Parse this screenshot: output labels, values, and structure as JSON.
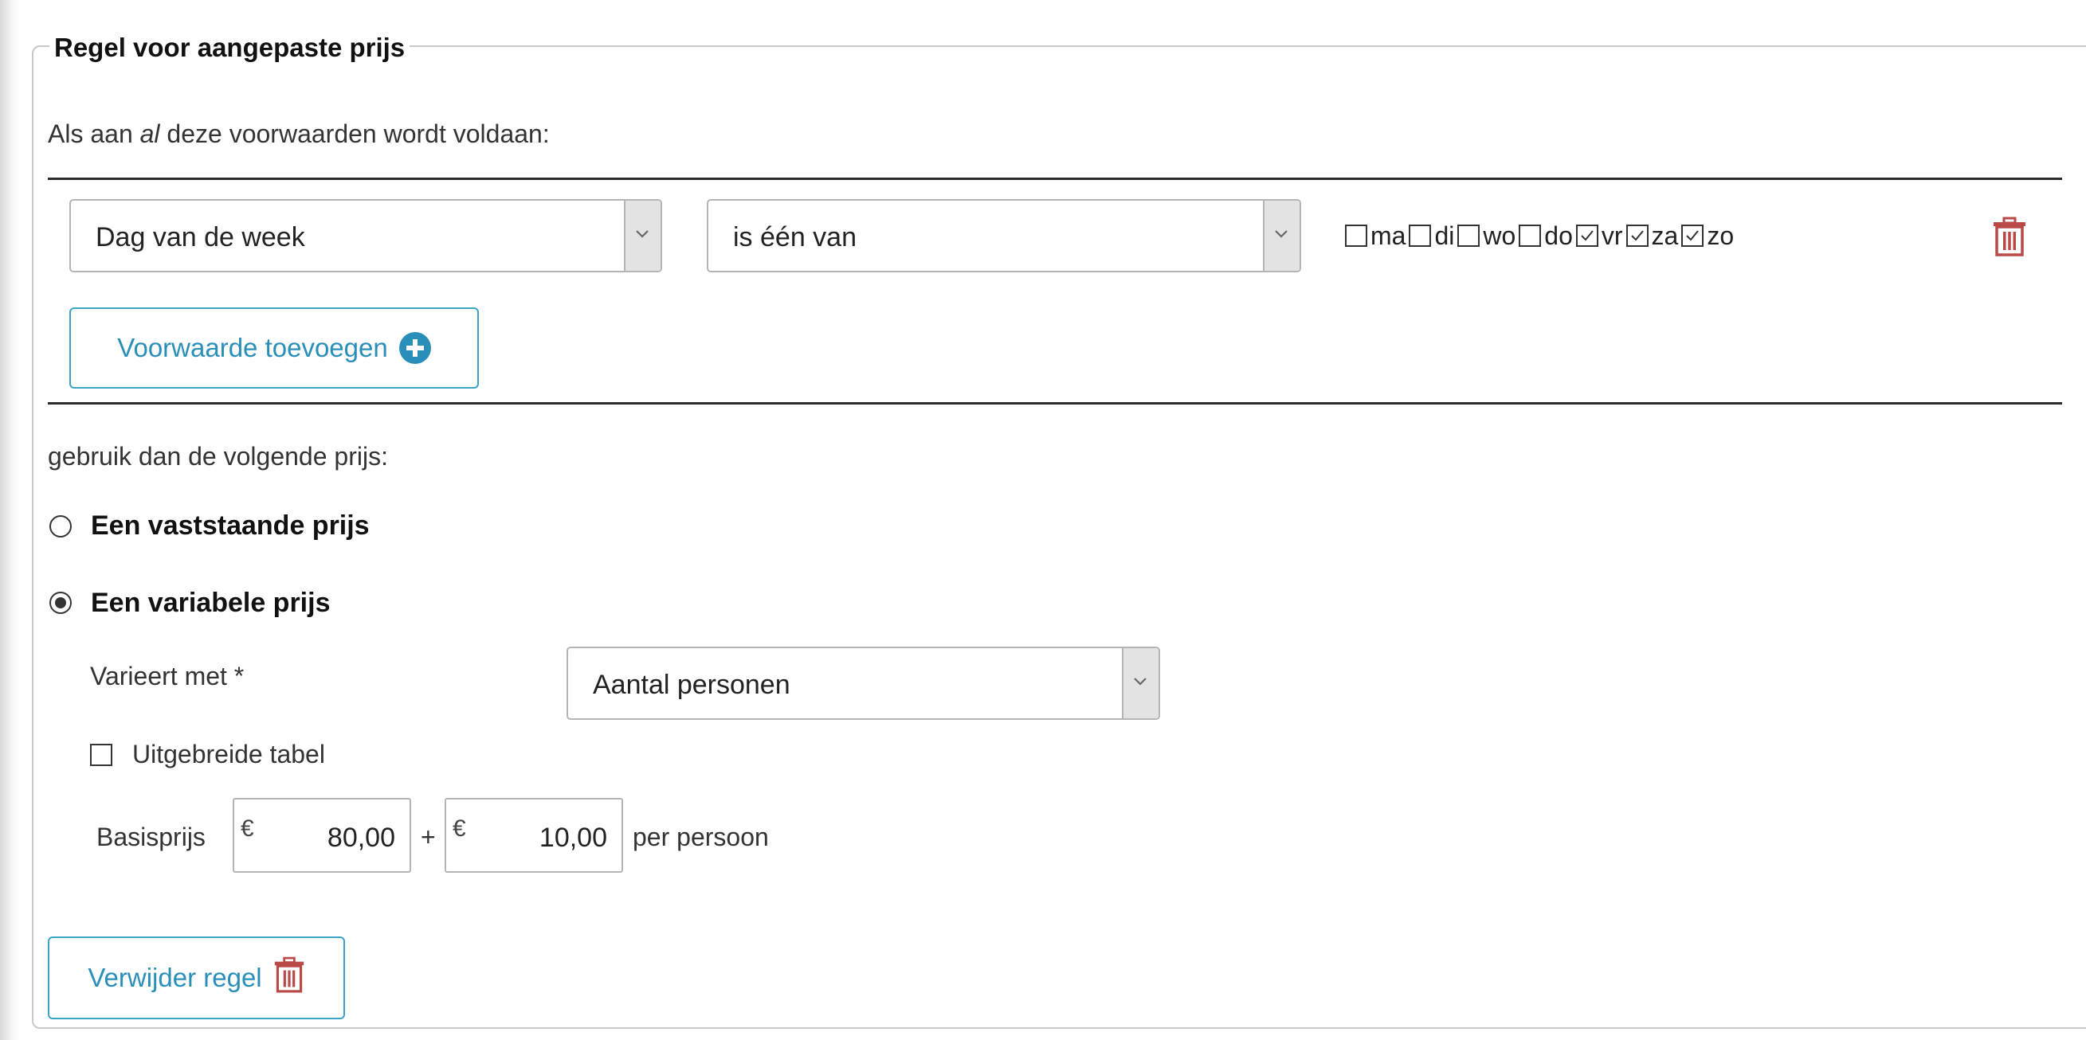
{
  "panel": {
    "legend": "Regel voor aangepaste prijs"
  },
  "conditions": {
    "intro_prefix": "Als aan ",
    "intro_emph": "al",
    "intro_suffix": " deze voorwaarden wordt voldaan:",
    "rows": [
      {
        "field_value": "Dag van de week",
        "operator_value": "is één van",
        "days": [
          {
            "label": "ma",
            "checked": false
          },
          {
            "label": "di",
            "checked": false
          },
          {
            "label": "wo",
            "checked": false
          },
          {
            "label": "do",
            "checked": false
          },
          {
            "label": "vr",
            "checked": true
          },
          {
            "label": "za",
            "checked": true
          },
          {
            "label": "zo",
            "checked": true
          }
        ]
      }
    ],
    "add_button_label": "Voorwaarde toevoegen"
  },
  "price": {
    "intro": "gebruik dan de volgende prijs:",
    "options": [
      {
        "label": "Een vaststaande prijs",
        "selected": false
      },
      {
        "label": "Een variabele prijs",
        "selected": true
      }
    ],
    "varies_label": "Varieert met *",
    "varies_value": "Aantal personen",
    "extended_table_label": "Uitgebreide tabel",
    "extended_table_checked": false,
    "base_label": "Basisprijs",
    "currency_symbol": "€",
    "base_amount": "80,00",
    "plus_sign": "+",
    "per_amount": "10,00",
    "per_label": "per persoon"
  },
  "remove_rule_label": "Verwijder regel",
  "colors": {
    "accent": "#2a8fb8",
    "delete": "#b94a48",
    "border": "#b5b5b5"
  }
}
